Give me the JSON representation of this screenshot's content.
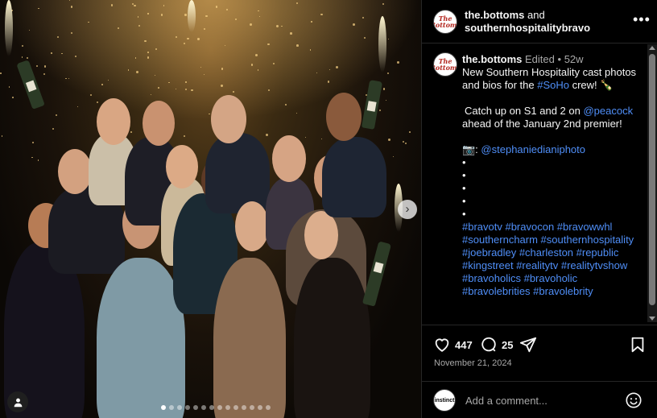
{
  "post": {
    "photo_alt": "Southern Hospitality cast photo",
    "carousel": {
      "total_dots": 14,
      "active_index": 0
    }
  },
  "header": {
    "account_primary": "the.bottoms",
    "connector": " and",
    "account_secondary": "southernhospitalitybravo",
    "more_label": "•••",
    "avatar_logo": "The Bottoms"
  },
  "caption": {
    "username": "the.bottoms",
    "edited": "Edited",
    "separator": "•",
    "age": "52w",
    "line1_text": "New Southern Hospitality cast photos and bios for the ",
    "line1_link": "#SoHo",
    "line1_end": " crew! 🍾",
    "line2_text": "Catch up on S1 and 2 on ",
    "line2_link": "@peacock",
    "line2_end": " ahead of the January 2nd premier!",
    "photo_credit_prefix": "📷: ",
    "photo_credit_link": "@stephaniedianiphoto",
    "bullets": [
      "•",
      "•",
      "•",
      "•",
      "•"
    ],
    "hashtags": "#bravotv #bravocon #bravowwhl #southerncharm #southernhospitality #joebradley #charleston #republic #kingstreet #realitytv #realitytvshow #bravoholics #bravoholic #bravolebrities #bravolebrity"
  },
  "actions": {
    "likes": "447",
    "comments": "25",
    "date": "November 21, 2024"
  },
  "comment_box": {
    "placeholder": "Add a comment...",
    "avatar_label": "instinct"
  },
  "colors": {
    "background": "#000000",
    "link": "#4f8ef7",
    "muted": "#a8a8a8",
    "text": "#f5f5f5"
  }
}
